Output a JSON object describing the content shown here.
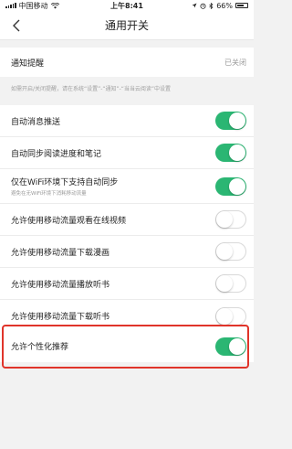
{
  "status_bar": {
    "carrier": "中国移动",
    "time": "上午8:41",
    "battery": "66%"
  },
  "nav": {
    "title": "通用开关"
  },
  "notification": {
    "label": "通知提醒",
    "value": "已关闭"
  },
  "hint": "如需开启/关闭提醒，请在系统“设置”-“通知”-“当当云阅读”中设置",
  "settings": [
    {
      "label": "自动消息推送",
      "on": true
    },
    {
      "label": "自动同步阅读进度和笔记",
      "on": true
    },
    {
      "label": "仅在WiFi环境下支持自动同步",
      "sub": "避免在无WiFi环境下消耗移动流量",
      "on": true
    },
    {
      "label": "允许使用移动流量观看在线视频",
      "on": false
    },
    {
      "label": "允许使用移动流量下载漫画",
      "on": false
    },
    {
      "label": "允许使用移动流量播放听书",
      "on": false
    },
    {
      "label": "允许使用移动流量下载听书",
      "on": false
    }
  ],
  "personalized": {
    "label": "允许个性化推荐",
    "on": true
  },
  "colors": {
    "toggle_on": "#2bb673",
    "highlight": "#e0342a"
  }
}
